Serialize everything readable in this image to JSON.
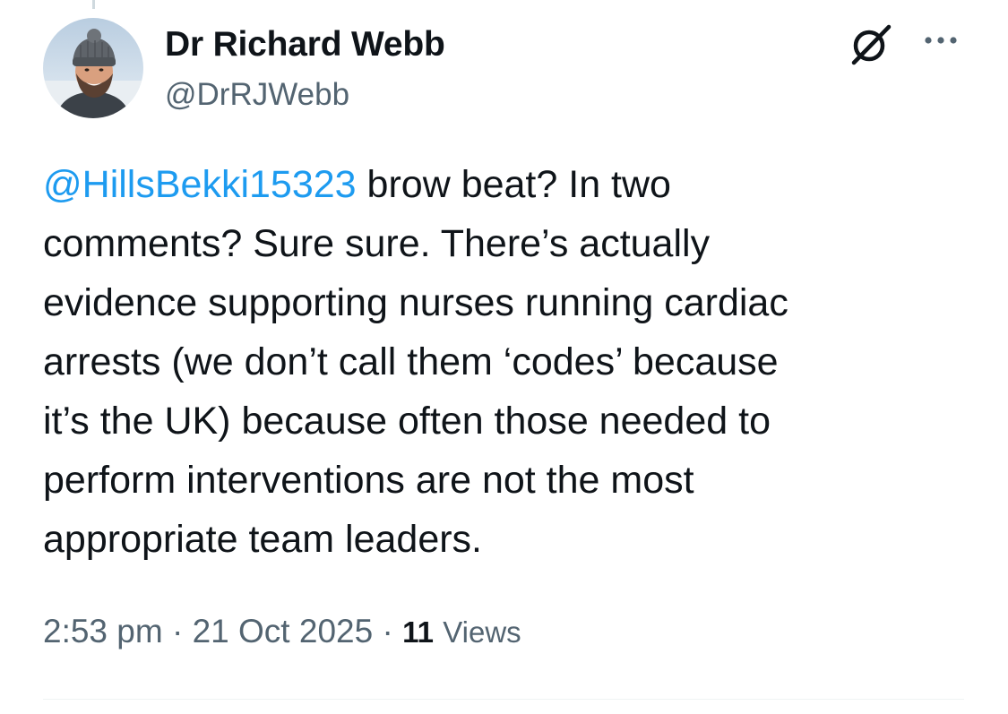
{
  "tweet": {
    "author": {
      "display_name": "Dr Richard Webb",
      "handle": "@DrRJWebb",
      "avatar_icon": "user-avatar-photo"
    },
    "text": {
      "mention": "@HillsBekki15323",
      "line1_rest": " brow beat? In two",
      "line2": "comments? Sure sure. There’s actually",
      "line3": "evidence supporting nurses running cardiac",
      "line4": "arrests (we don’t call them ‘codes’ because",
      "line5": "it’s the UK) because often those needed to",
      "line6": "perform interventions are not the most",
      "line7": "appropriate team leaders."
    },
    "time": "2:53 pm",
    "separator": "·",
    "date": "21 Oct 2025",
    "views_count": "11",
    "views_label": "Views"
  },
  "header_actions": {
    "grok_icon": "grok-icon",
    "more_icon": "more-options-icon"
  },
  "colors": {
    "text_primary": "#0f1419",
    "text_secondary": "#536471",
    "accent_link": "#1d9bf0",
    "divider": "#eff3f4"
  }
}
